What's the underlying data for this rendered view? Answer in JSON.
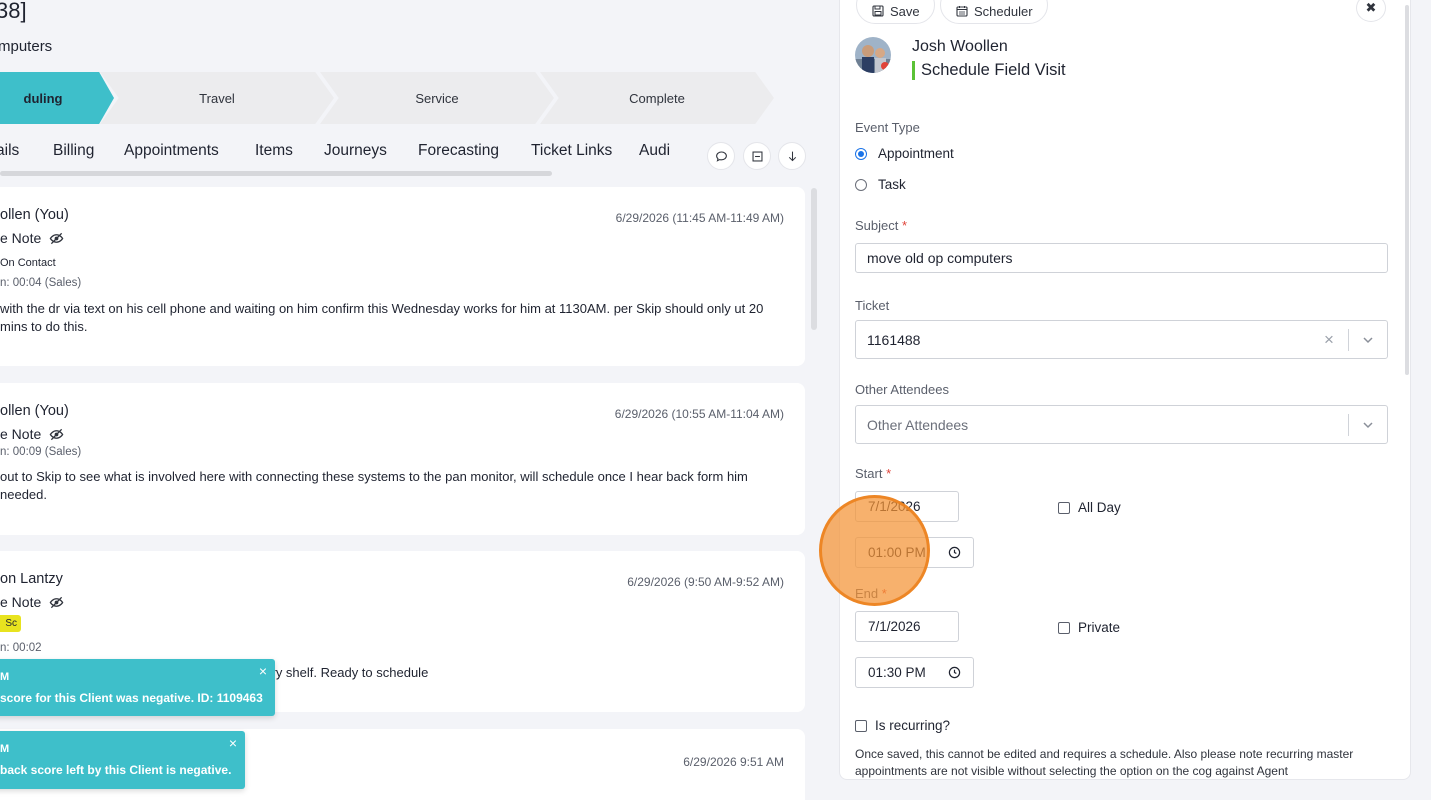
{
  "header": {
    "title": "38]",
    "subtitle": "mputers"
  },
  "stages": [
    {
      "label": "duling",
      "state": "active"
    },
    {
      "label": "Travel",
      "state": "pending"
    },
    {
      "label": "Service",
      "state": "pending"
    },
    {
      "label": "Complete",
      "state": "pending"
    }
  ],
  "tabs": [
    "ails",
    "Billing",
    "Appointments",
    "Items",
    "Journeys",
    "Forecasting",
    "Ticket Links",
    "Audi"
  ],
  "tab_actions": [
    "comment-icon",
    "list-collapse-icon",
    "download-arrow-icon"
  ],
  "notes": [
    {
      "author": "ollen (You)",
      "type": "e Note",
      "contact": "On Contact",
      "duration": "n: 00:04 (Sales)",
      "time": "6/29/2026 (11:45 AM-11:49 AM)",
      "body": "with the dr via text on his cell phone and waiting on him confirm this Wednesday works for him at 1130AM.  per Skip should only ut 20 mins to do this."
    },
    {
      "author": "ollen (You)",
      "type": "e Note",
      "duration": "n: 00:09 (Sales)",
      "time": "6/29/2026 (10:55 AM-11:04 AM)",
      "body": "out to Skip to see what is involved here with connecting these systems to the pan monitor, will schedule once I hear back form him needed."
    },
    {
      "author": "on Lantzy",
      "type": "e Note",
      "badge": "Sc",
      "duration": "n: 00:02",
      "time": "6/29/2026 (9:50 AM-9:52 AM)",
      "body": "oollen This arrived and is placed on the inventory shelf. Ready to schedule"
    },
    {
      "author": "",
      "time": "6/29/2026 9:51 AM"
    }
  ],
  "toasts": [
    {
      "title": "M",
      "message": "score for this Client was negative. ID: 1109463",
      "close": "×"
    },
    {
      "title": "M",
      "message": "back score left by this Client is negative.",
      "close": "×"
    }
  ],
  "panel": {
    "save_label": "Save",
    "scheduler_label": "Scheduler",
    "close_label": "✖",
    "user_name": "Josh Woollen",
    "title": "Schedule Field Visit",
    "event_type_label": "Event Type",
    "event_types": [
      "Appointment",
      "Task"
    ],
    "event_type_selected": "Appointment",
    "subject_label": "Subject",
    "subject_value": "move old op computers",
    "ticket_label": "Ticket",
    "ticket_value": "1161488",
    "attendees_label": "Other Attendees",
    "attendees_placeholder": "Other Attendees",
    "start_label": "Start",
    "start_date": "7/1/2026",
    "start_time": "01:00 PM",
    "all_day_label": "All Day",
    "end_label": "End",
    "end_date": "7/1/2026",
    "end_time": "01:30 PM",
    "private_label": "Private",
    "recurring_label": "Is recurring?",
    "recurring_note": "Once saved, this cannot be edited and requires a schedule. Also please note recurring master appointments are not visible without selecting the option on the cog against Agent",
    "required_mark": "*"
  },
  "colors": {
    "accent_teal": "#3ebfca",
    "title_bar_green": "#5bc236",
    "radio_blue": "#1a73e8",
    "required_red": "#e0443a",
    "badge_yellow": "#e8e31f",
    "cursor_orange": "#f49334"
  }
}
